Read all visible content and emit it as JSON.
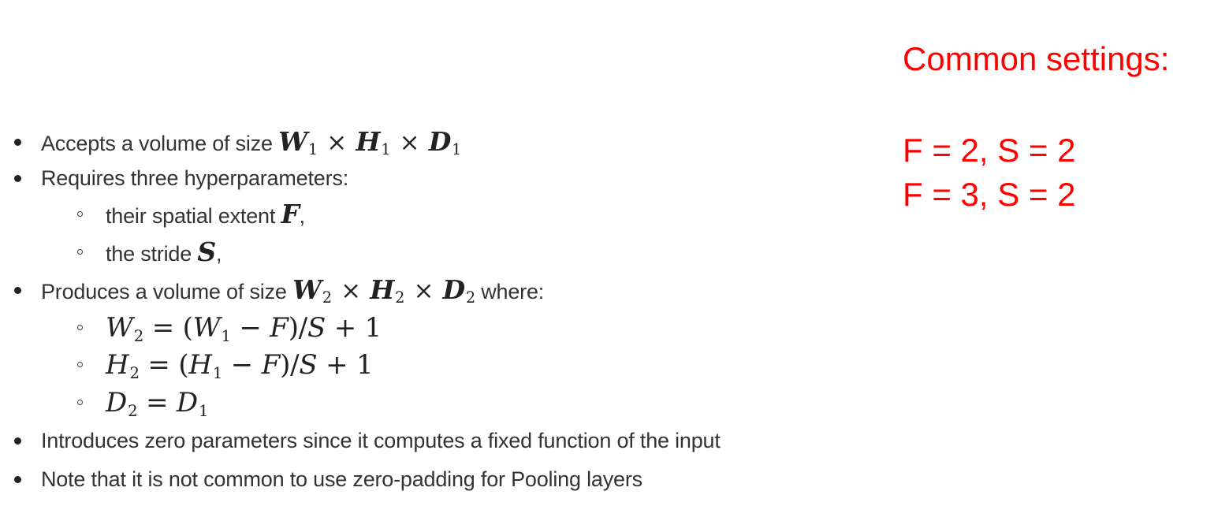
{
  "bullets": [
    {
      "level": 1,
      "text": "Accepts a volume of size",
      "math": "W1 × H1 × D1"
    },
    {
      "level": 1,
      "text": "Requires three hyperparameters:"
    },
    {
      "level": 2,
      "text": "their spatial extent",
      "math": "F",
      "suffix": ","
    },
    {
      "level": 2,
      "text": "the stride",
      "math": "S",
      "suffix": ","
    },
    {
      "level": 1,
      "text": "Produces a volume of size",
      "math": "W2 × H2 × D2",
      "suffix": "where:"
    },
    {
      "level": 2,
      "math": "W2 = (W1 − F)/S + 1"
    },
    {
      "level": 2,
      "math": "H2 = (H1 − F)/S + 1"
    },
    {
      "level": 2,
      "math": "D2 = D1"
    },
    {
      "level": 1,
      "text": "Introduces zero parameters since it computes a fixed function of the input"
    },
    {
      "level": 1,
      "text": "Note that it is not common to use zero-padding for Pooling layers"
    }
  ],
  "panel": {
    "title": "Common settings:",
    "settings": [
      "F = 2, S = 2",
      "F = 3, S = 2"
    ],
    "color": "#ff0000"
  }
}
